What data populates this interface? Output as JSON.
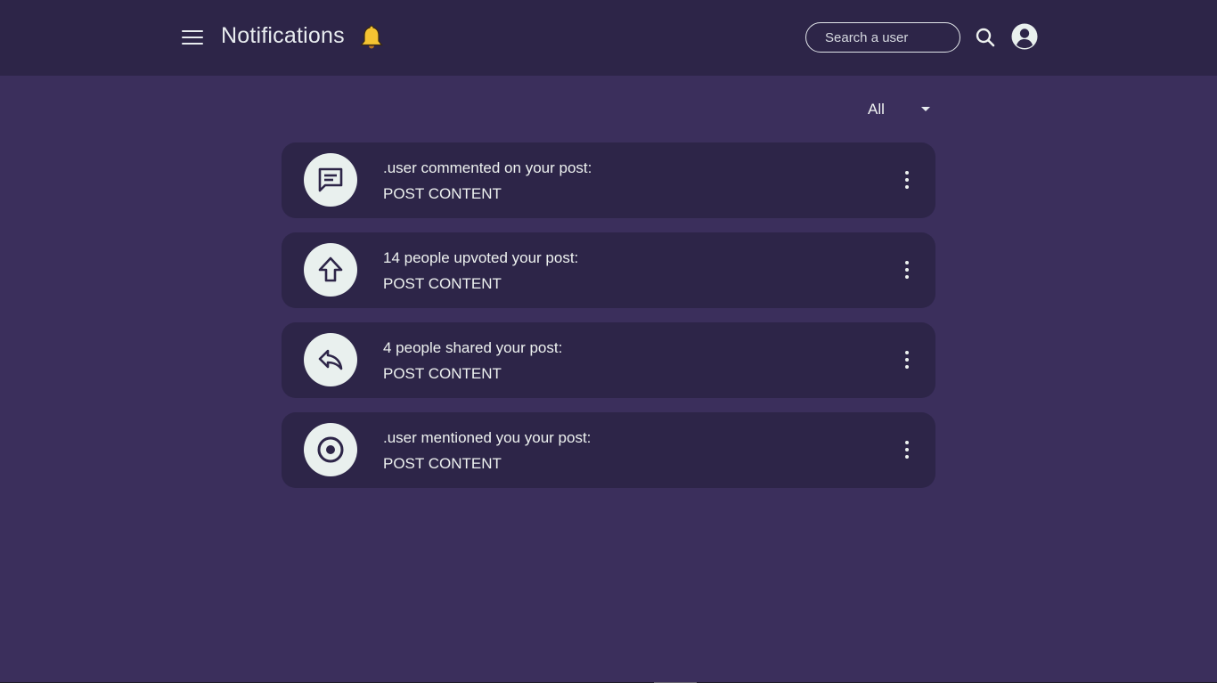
{
  "header": {
    "title": "Notifications",
    "title_icon": "bell-icon",
    "menu_icon": "hamburger-menu-icon",
    "search": {
      "placeholder": "Search a user",
      "value": ""
    },
    "search_icon": "search-icon",
    "profile_icon": "user-avatar-icon"
  },
  "filter": {
    "selected": "All",
    "icon": "caret-down-icon"
  },
  "notifications": [
    {
      "icon": "comment-icon",
      "title": ".user commented on your post:",
      "content": "POST CONTENT"
    },
    {
      "icon": "upvote-arrow-icon",
      "title": "14 people upvoted your post:",
      "content": "POST CONTENT"
    },
    {
      "icon": "share-reply-icon",
      "title": "4 people shared your post:",
      "content": "POST CONTENT"
    },
    {
      "icon": "mention-target-icon",
      "title": ".user mentioned you your post:",
      "content": "POST CONTENT"
    }
  ],
  "colors": {
    "background": "#3b2f5c",
    "header": "#2d2548",
    "card": "#2d2548",
    "icon_circle": "#e9f0ee",
    "icon_glyph": "#2d2548",
    "text": "#eef2f0",
    "bell": "#f5c432"
  }
}
